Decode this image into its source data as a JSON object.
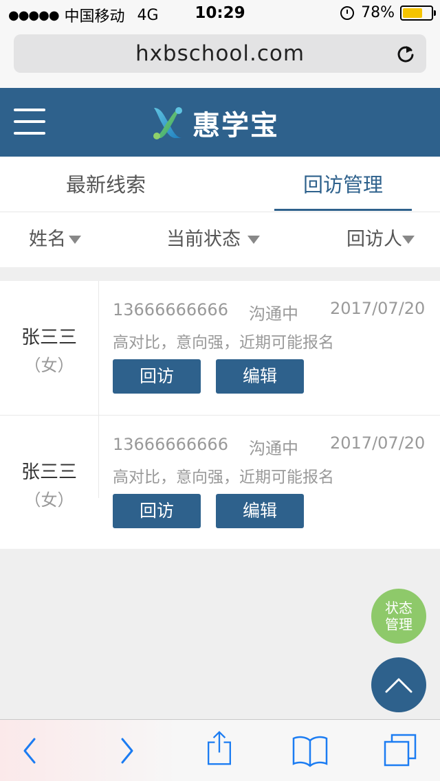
{
  "status_bar": {
    "carrier": "中国移动",
    "network": "4G",
    "time": "10:29",
    "battery": "78%",
    "battery_level": 0.78
  },
  "browser": {
    "url": "hxbschool.com",
    "reload_icon": "reload-icon"
  },
  "header": {
    "app_name": "惠学宝",
    "brand_color": "#2e618c",
    "menu_icon": "hamburger-icon"
  },
  "tabs": [
    {
      "label": "最新线索",
      "active": false
    },
    {
      "label": "回访管理",
      "active": true
    }
  ],
  "filters": [
    {
      "label": "姓名"
    },
    {
      "label": "当前状态"
    },
    {
      "label": "回访人"
    }
  ],
  "records": [
    {
      "name": "张三三",
      "gender": "（女）",
      "phone": "13666666666",
      "status": "沟通中",
      "date": "2017/07/20",
      "note": "高对比，意向强，近期可能报名",
      "visit_label": "回访",
      "edit_label": "编辑"
    },
    {
      "name": "张三三",
      "gender": "（女）",
      "phone": "13666666666",
      "status": "沟通中",
      "date": "2017/07/20",
      "note": "高对比，意向强，近期可能报名",
      "visit_label": "回访",
      "edit_label": "编辑"
    }
  ],
  "floating": {
    "status_manage_line1": "状态",
    "status_manage_line2": "管理",
    "status_color": "#8ec96a",
    "back_to_top_icon": "chevron-up-icon"
  },
  "toolbar": {
    "icons": [
      "back-icon",
      "forward-icon",
      "share-icon",
      "bookmarks-icon",
      "tabs-icon"
    ],
    "accent": "#1b7cf2"
  }
}
